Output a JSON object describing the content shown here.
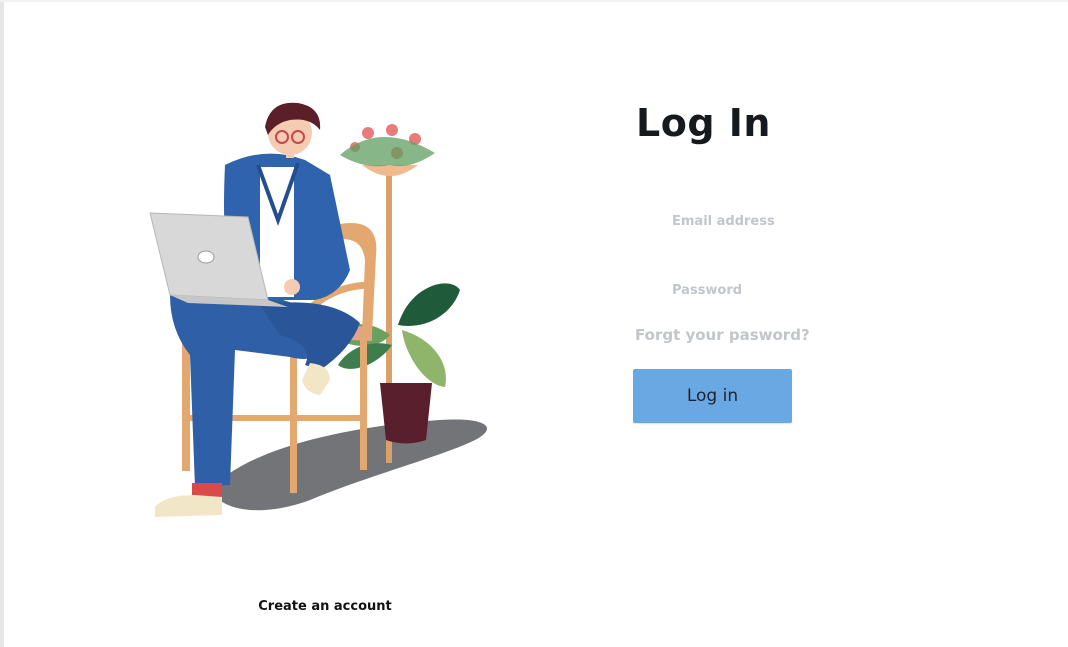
{
  "login": {
    "title": "Log In",
    "email_placeholder": "Email address",
    "password_placeholder": "Password",
    "forgot_link": "Forgt your pasword?",
    "login_button": "Log in"
  },
  "footer": {
    "create_account": "Create an account"
  },
  "colors": {
    "button": "#6aa8e4",
    "placeholder": "#c2c6cc",
    "title": "#151a1f"
  }
}
